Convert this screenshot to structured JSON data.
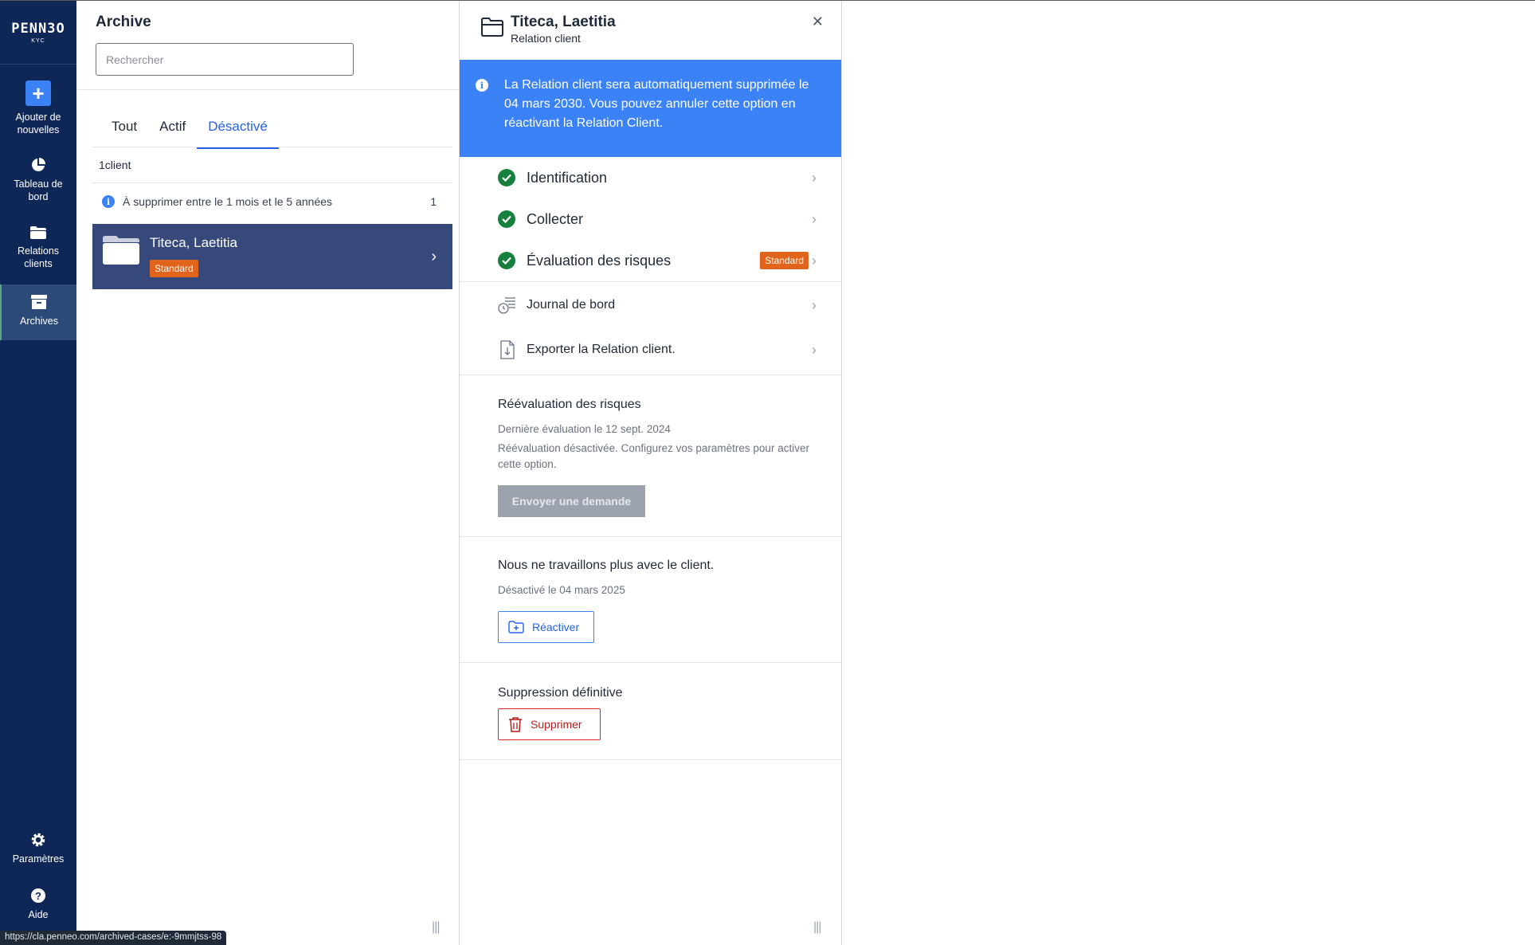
{
  "sidebar": {
    "logo": "PENN3O",
    "logo_sub": "KYC",
    "items": [
      {
        "label": "Ajouter de nouvelles",
        "icon": "plus-icon"
      },
      {
        "label": "Tableau de bord",
        "icon": "pie-chart-icon"
      },
      {
        "label": "Relations clients",
        "icon": "folder-icon"
      },
      {
        "label": "Archives",
        "icon": "archive-icon"
      }
    ],
    "settings_label": "Paramètres",
    "help_label": "Aide"
  },
  "list": {
    "title": "Archive",
    "search_placeholder": "Rechercher",
    "tabs": [
      {
        "label": "Tout",
        "active": false
      },
      {
        "label": "Actif",
        "active": false
      },
      {
        "label": "Désactivé",
        "active": true
      }
    ],
    "count_label": "1client",
    "group": {
      "label": "À supprimer entre le 1 mois et le 5 années",
      "count": "1"
    },
    "client": {
      "name": "Titeca, Laetitia",
      "badge": "Standard"
    }
  },
  "detail": {
    "title": "Titeca, Laetitia",
    "subtitle": "Relation client",
    "banner": "La Relation client sera automatiquement supprimée le 04 mars 2030. Vous pouvez annuler cette option en réactivant la Relation Client.",
    "steps": [
      {
        "label": "Identification",
        "status": "complete",
        "badge": ""
      },
      {
        "label": "Collecter",
        "status": "complete",
        "badge": ""
      },
      {
        "label": "Évaluation des risques",
        "status": "complete",
        "badge": "Standard"
      }
    ],
    "menu": [
      {
        "label": "Journal de bord",
        "icon": "log-clock-icon"
      },
      {
        "label": "Exporter la Relation client.",
        "icon": "export-file-icon"
      }
    ],
    "reassessment": {
      "title": "Réévaluation des risques",
      "last": "Dernière évaluation le 12 sept. 2024",
      "note": "Réévaluation désactivée. Configurez vos paramètres pour activer cette option.",
      "button": "Envoyer une demande"
    },
    "deactivated": {
      "title": "Nous ne travaillons plus avec le client.",
      "date": "Désactivé le 04 mars 2025",
      "button": "Réactiver"
    },
    "deletion": {
      "title": "Suppression définitive",
      "button": "Supprimer"
    }
  },
  "status_url": "https://cla.penneo.com/archived-cases/e:-9mmjtss-98",
  "colors": {
    "sidebar": "#0f2757",
    "accent": "#3b82f6",
    "badge": "#e0641c",
    "success": "#16803c",
    "danger": "#dc2626",
    "selected_row": "#37487a"
  }
}
